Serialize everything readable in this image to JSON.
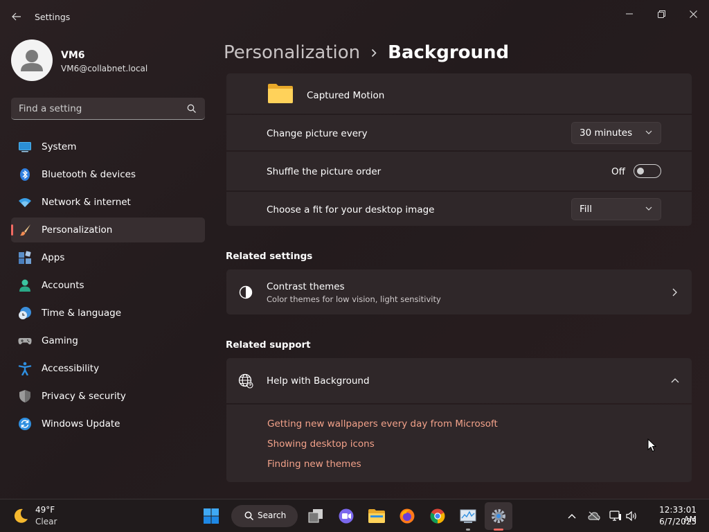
{
  "window": {
    "title": "Settings"
  },
  "user": {
    "name": "VM6",
    "email": "VM6@collabnet.local"
  },
  "search": {
    "placeholder": "Find a setting"
  },
  "sidebar": {
    "items": [
      {
        "label": "System",
        "icon": "system-icon"
      },
      {
        "label": "Bluetooth & devices",
        "icon": "bluetooth-icon"
      },
      {
        "label": "Network & internet",
        "icon": "wifi-icon"
      },
      {
        "label": "Personalization",
        "icon": "brush-icon",
        "selected": true
      },
      {
        "label": "Apps",
        "icon": "apps-icon"
      },
      {
        "label": "Accounts",
        "icon": "person-icon"
      },
      {
        "label": "Time & language",
        "icon": "clock-globe-icon"
      },
      {
        "label": "Gaming",
        "icon": "gamepad-icon"
      },
      {
        "label": "Accessibility",
        "icon": "accessibility-icon"
      },
      {
        "label": "Privacy & security",
        "icon": "shield-icon"
      },
      {
        "label": "Windows Update",
        "icon": "update-icon"
      }
    ]
  },
  "header": {
    "parent": "Personalization",
    "current": "Background"
  },
  "background": {
    "folder_name": "Captured Motion",
    "change_picture_label": "Change picture every",
    "change_picture_value": "30 minutes",
    "shuffle_label": "Shuffle the picture order",
    "shuffle_state": "Off",
    "fit_label": "Choose a fit for your desktop image",
    "fit_value": "Fill"
  },
  "related_settings": {
    "title": "Related settings",
    "contrast_title": "Contrast themes",
    "contrast_subtitle": "Color themes for low vision, light sensitivity"
  },
  "related_support": {
    "title": "Related support",
    "help_title": "Help with Background",
    "links": [
      "Getting new wallpapers every day from Microsoft",
      "Showing desktop icons",
      "Finding new themes"
    ]
  },
  "taskbar": {
    "weather_temp": "49°F",
    "weather_desc": "Clear",
    "search_label": "Search",
    "time": "12:33:01 AM",
    "date": "6/7/2023"
  },
  "colors": {
    "accent": "#f06a62",
    "link": "#f3a28a",
    "card": "#2f2729",
    "background": "#241c1d"
  }
}
